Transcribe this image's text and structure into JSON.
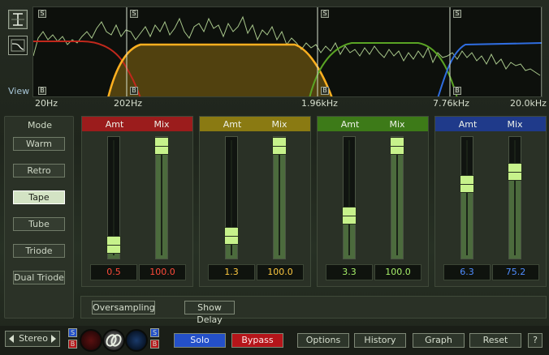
{
  "view": {
    "label": "View"
  },
  "graph": {
    "band_markers": [
      "S",
      "B"
    ],
    "freq_labels": [
      "20Hz",
      "202Hz",
      "1.96kHz",
      "7.76kHz",
      "20.0kHz"
    ]
  },
  "mode": {
    "title": "Mode",
    "options": [
      "Warm",
      "Retro",
      "Tape",
      "Tube",
      "Triode",
      "Dual Triode"
    ],
    "selected": "Tape"
  },
  "bands": [
    {
      "color": "#9b1c1c",
      "text_color": "#ff4a3a",
      "amt_label": "Amt",
      "mix_label": "Mix",
      "amt": "0.5",
      "mix": "100.0",
      "amt_level": 0.05,
      "mix_level": 1.0
    },
    {
      "color": "#8a7a12",
      "text_color": "#ffc940",
      "amt_label": "Amt",
      "mix_label": "Mix",
      "amt": "1.3",
      "mix": "100.0",
      "amt_level": 0.13,
      "mix_level": 1.0
    },
    {
      "color": "#3d7a18",
      "text_color": "#a7f06a",
      "amt_label": "Amt",
      "mix_label": "Mix",
      "amt": "3.3",
      "mix": "100.0",
      "amt_level": 0.33,
      "mix_level": 1.0
    },
    {
      "color": "#1f3a8a",
      "text_color": "#4f8dff",
      "amt_label": "Amt",
      "mix_label": "Mix",
      "amt": "6.3",
      "mix": "75.2",
      "amt_level": 0.63,
      "mix_level": 0.752
    }
  ],
  "options": {
    "oversampling": "Oversampling",
    "show_delay": "Show Delay"
  },
  "bottom": {
    "channel": "Stereo",
    "s": "S",
    "b": "B",
    "solo": "Solo",
    "bypass": "Bypass",
    "options": "Options",
    "history": "History",
    "graph": "Graph",
    "reset": "Reset",
    "help": "?"
  },
  "colors": {
    "solo": "#2450c8",
    "bypass": "#b5151a"
  }
}
